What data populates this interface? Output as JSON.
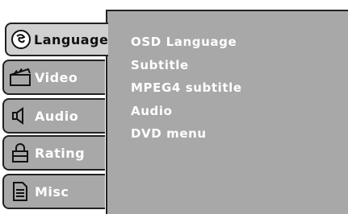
{
  "tabs": [
    {
      "label": "Language",
      "icon": "language-icon",
      "active": true
    },
    {
      "label": "Video",
      "icon": "clapperboard-icon",
      "active": false
    },
    {
      "label": "Audio",
      "icon": "speaker-icon",
      "active": false
    },
    {
      "label": "Rating",
      "icon": "lock-icon",
      "active": false
    },
    {
      "label": "Misc",
      "icon": "document-icon",
      "active": false
    }
  ],
  "menu_items": [
    "OSD Language",
    "Subtitle",
    "MPEG4 subtitle",
    "Audio",
    "DVD menu"
  ],
  "colors": {
    "panel": "#a8a8a8",
    "active_tab": "#d0d0d0",
    "text": "#ffffff",
    "border": "#222222"
  }
}
